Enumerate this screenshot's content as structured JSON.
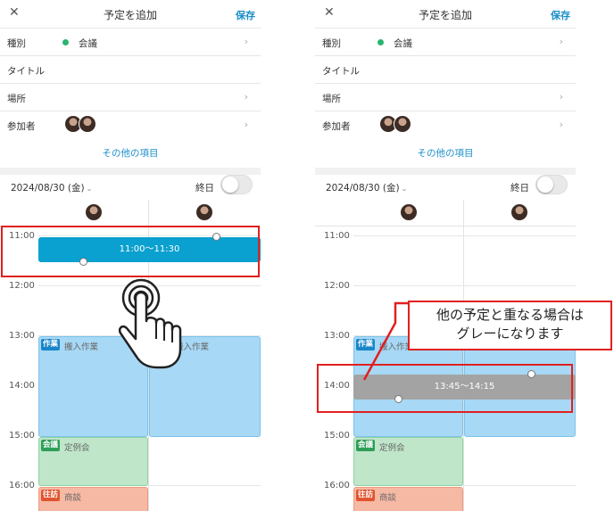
{
  "header": {
    "title": "予定を追加",
    "save_label": "保存",
    "close_glyph": "✕"
  },
  "form": {
    "type_label": "種別",
    "type_value": "会議",
    "type_color": "#2ab56f",
    "title_label": "タイトル",
    "place_label": "場所",
    "attendees_label": "参加者",
    "more_items": "その他の項目"
  },
  "date": {
    "value": "2024/08/30 (金)",
    "allday_label": "終日",
    "chevron": "⌄"
  },
  "hours": [
    "11:00",
    "12:00",
    "13:00",
    "14:00",
    "15:00",
    "16:00"
  ],
  "events": {
    "work": {
      "tag": "作業",
      "name": "搬入作業"
    },
    "meeting": {
      "tag": "会議",
      "name": "定例会"
    },
    "visit": {
      "tag": "往訪",
      "name": "商談"
    }
  },
  "left_new_event": {
    "time": "11:00〜11:30",
    "color": "#0aa0cf"
  },
  "right_new_event": {
    "time": "13:45〜14:15",
    "color": "#a3a3a3"
  },
  "annotation": {
    "line1": "他の予定と重なる場合は",
    "line2": "グレーになります",
    "color": "#e02020"
  }
}
